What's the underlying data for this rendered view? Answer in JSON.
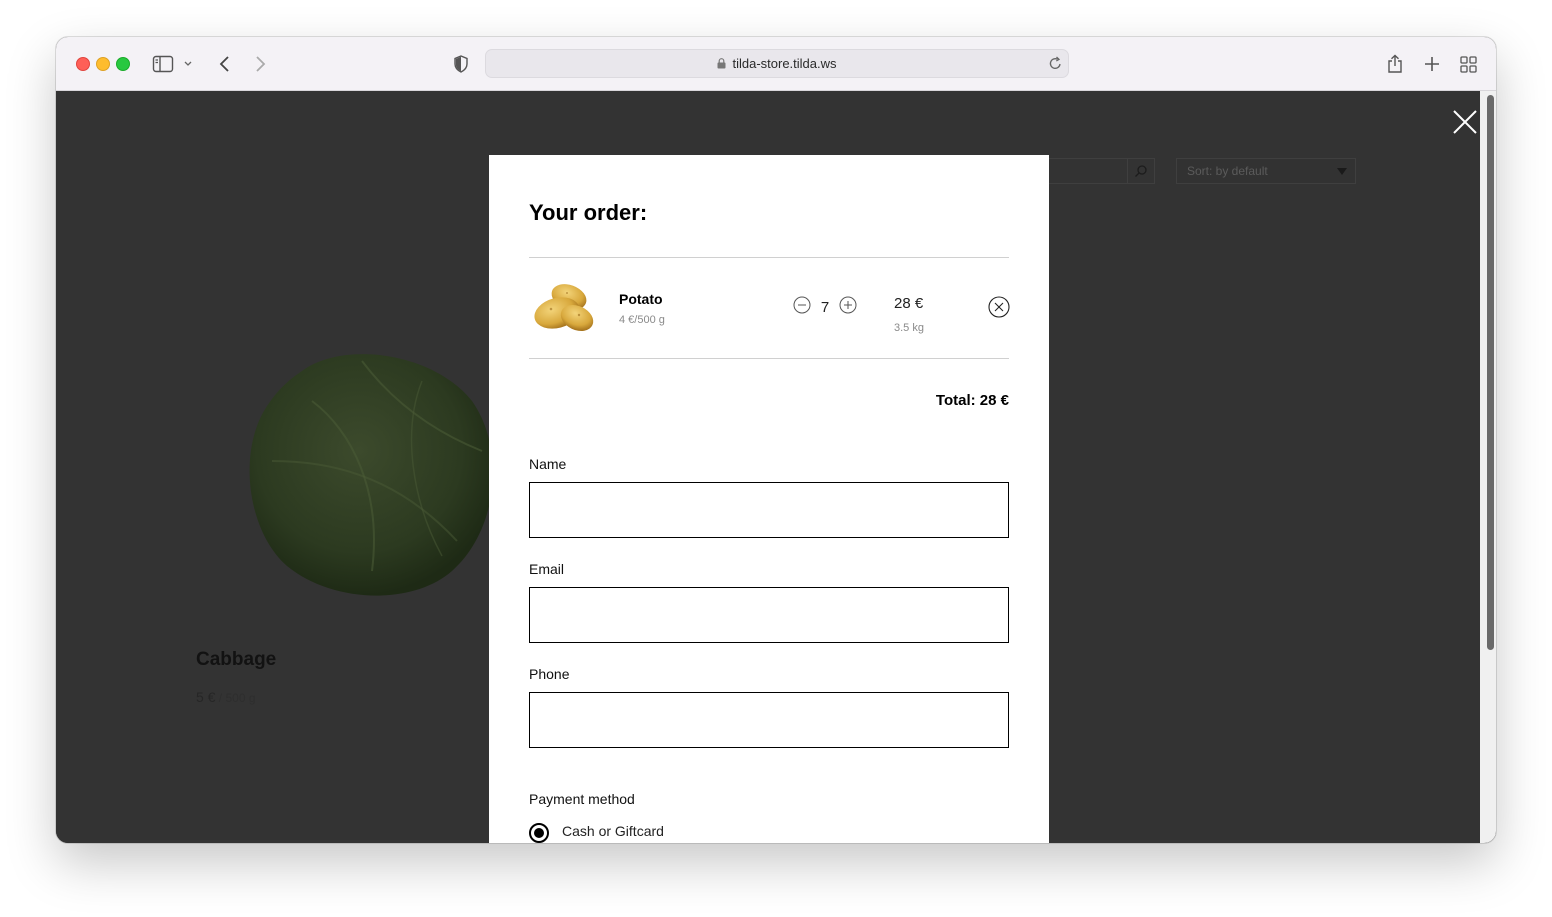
{
  "browser": {
    "url": "tilda-store.tilda.ws"
  },
  "background_page": {
    "sort_label": "Sort: by default",
    "product": {
      "title": "Cabbage",
      "price": "5 €",
      "unit": " / 500 g"
    }
  },
  "cart": {
    "title": "Your order:",
    "items": [
      {
        "name": "Potato",
        "unit_price": "4 €/500 g",
        "quantity": "7",
        "price": "28 €",
        "weight": "3.5 kg"
      }
    ],
    "total": "Total: 28 €"
  },
  "form": {
    "name_label": "Name",
    "email_label": "Email",
    "phone_label": "Phone",
    "payment_label": "Payment method",
    "payment_option": "Cash or Giftcard"
  },
  "colors": {
    "overlay": "#333333",
    "accent": "#000000"
  }
}
